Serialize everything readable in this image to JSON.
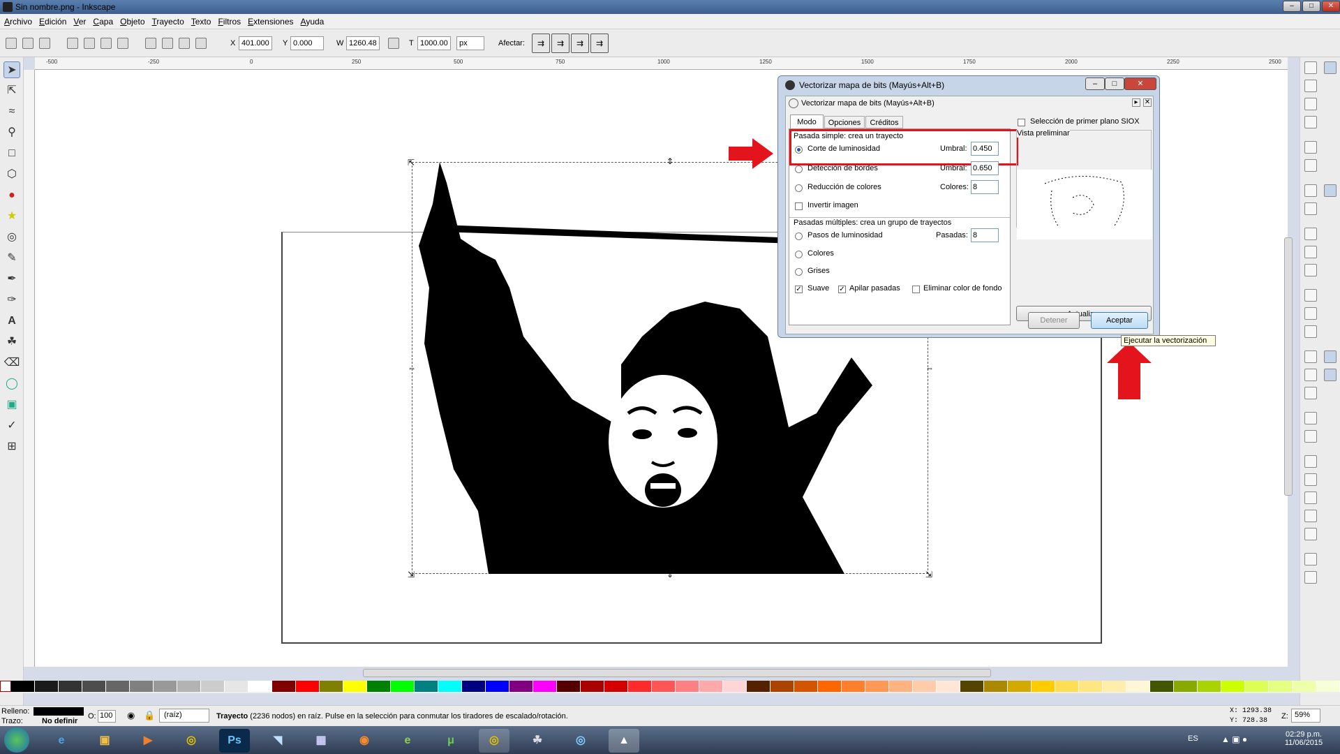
{
  "window": {
    "title": "Sin nombre.png - Inkscape"
  },
  "menu": [
    "Archivo",
    "Edición",
    "Ver",
    "Capa",
    "Objeto",
    "Trayecto",
    "Texto",
    "Filtros",
    "Extensiones",
    "Ayuda"
  ],
  "toolbar": {
    "x_label": "X",
    "x_value": "401.000",
    "y_label": "Y",
    "y_value": "0.000",
    "w_label": "W",
    "w_value": "1260.48",
    "h_label": "T",
    "h_value": "1000.00",
    "unit": "px",
    "afectar_label": "Afectar:"
  },
  "ruler": {
    "ticks": [
      "-500",
      "-250",
      "0",
      "250",
      "500",
      "750",
      "1000",
      "1250",
      "1500",
      "1750",
      "2000",
      "2250",
      "2500"
    ]
  },
  "dialog": {
    "window_title": "Vectorizar mapa de bits (Mayús+Alt+B)",
    "panel_title": "Vectorizar mapa de bits (Mayús+Alt+B)",
    "tabs": [
      "Modo",
      "Opciones",
      "Créditos"
    ],
    "siox_label": "Selección de primer plano SIOX",
    "preview_label": "Vista preliminar",
    "single_group_label": "Pasada simple: crea un trayecto",
    "multi_group_label": "Pasadas múltiples: crea un grupo de trayectos",
    "options": {
      "brightness": {
        "label": "Corte de luminosidad",
        "param_label": "Umbral:",
        "value": "0.450"
      },
      "edges": {
        "label": "Detección de bordes",
        "param_label": "Umbral:",
        "value": "0.650"
      },
      "colors": {
        "label": "Reducción de colores",
        "param_label": "Colores:",
        "value": "8"
      },
      "invert": {
        "label": "Invertir imagen"
      },
      "steps": {
        "label": "Pasos de luminosidad",
        "param_label": "Pasadas:",
        "value": "8"
      },
      "multi_colors": {
        "label": "Colores"
      },
      "grays": {
        "label": "Grises"
      },
      "smooth": {
        "label": "Suave"
      },
      "stack": {
        "label": "Apilar pasadas"
      },
      "remove_bg": {
        "label": "Eliminar color de fondo"
      }
    },
    "buttons": {
      "update": "Actualizar",
      "stop": "Detener",
      "ok": "Aceptar"
    },
    "tooltip": "Ejecutar la vectorización"
  },
  "status": {
    "fill_label": "Relleno:",
    "stroke_label": "Trazo:",
    "stroke_value": "No definir",
    "opacity_label": "O:",
    "opacity_value": "100",
    "layer": "(raíz)",
    "message_bold": "Trayecto",
    "message": " (2236 nodos) en raíz. Pulse en la selección para conmutar los tiradores de escalado/rotación.",
    "x_coord": "X: 1293.38",
    "y_coord": "Y:  728.38",
    "zoom_label": "Z:",
    "zoom": "59%"
  },
  "taskbar": {
    "lang": "ES",
    "time": "02:29 p.m.",
    "date": "11/06/2015"
  },
  "palette": [
    "#000000",
    "#1a1a1a",
    "#333333",
    "#4d4d4d",
    "#666666",
    "#808080",
    "#999999",
    "#b3b3b3",
    "#cccccc",
    "#e6e6e6",
    "#ffffff",
    "#800000",
    "#ff0000",
    "#808000",
    "#ffff00",
    "#008000",
    "#00ff00",
    "#008080",
    "#00ffff",
    "#000080",
    "#0000ff",
    "#800080",
    "#ff00ff",
    "#550000",
    "#aa0000",
    "#d40000",
    "#ff2a2a",
    "#ff5555",
    "#ff8080",
    "#ffaaaa",
    "#ffd5d5",
    "#552200",
    "#aa4400",
    "#d45500",
    "#ff6600",
    "#ff7f2a",
    "#ff9955",
    "#ffb380",
    "#ffccaa",
    "#ffe6d5",
    "#554400",
    "#aa8800",
    "#d4aa00",
    "#ffcc00",
    "#ffdd55",
    "#ffe680",
    "#ffeeaa",
    "#fff6d5",
    "#445500",
    "#88aa00",
    "#aad400",
    "#ccff00",
    "#ddff55",
    "#e5ff80",
    "#eeffaa",
    "#f6ffd5"
  ]
}
